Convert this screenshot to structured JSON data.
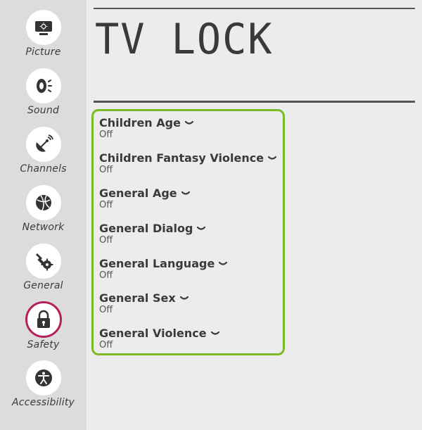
{
  "sidebar": {
    "items": [
      {
        "label": "Picture",
        "icon": "picture-icon"
      },
      {
        "label": "Sound",
        "icon": "sound-icon"
      },
      {
        "label": "Channels",
        "icon": "channels-icon"
      },
      {
        "label": "Network",
        "icon": "network-icon"
      },
      {
        "label": "General",
        "icon": "general-icon"
      },
      {
        "label": "Safety",
        "icon": "lock-icon",
        "selected": true
      },
      {
        "label": "Accessibility",
        "icon": "accessibility-icon"
      }
    ]
  },
  "main": {
    "title": "TV LOCK",
    "options": [
      {
        "label": "Children Age",
        "value": "Off"
      },
      {
        "label": "Children Fantasy Violence",
        "value": "Off"
      },
      {
        "label": "General Age",
        "value": "Off"
      },
      {
        "label": "General Dialog",
        "value": "Off"
      },
      {
        "label": "General Language",
        "value": "Off"
      },
      {
        "label": "General Sex",
        "value": "Off"
      },
      {
        "label": "General Violence",
        "value": "Off"
      }
    ]
  },
  "colors": {
    "selected_ring": "#b51f5c",
    "highlight_box": "#7cba27",
    "sidebar_bg": "#dcdcdc",
    "page_bg": "#ececec"
  }
}
